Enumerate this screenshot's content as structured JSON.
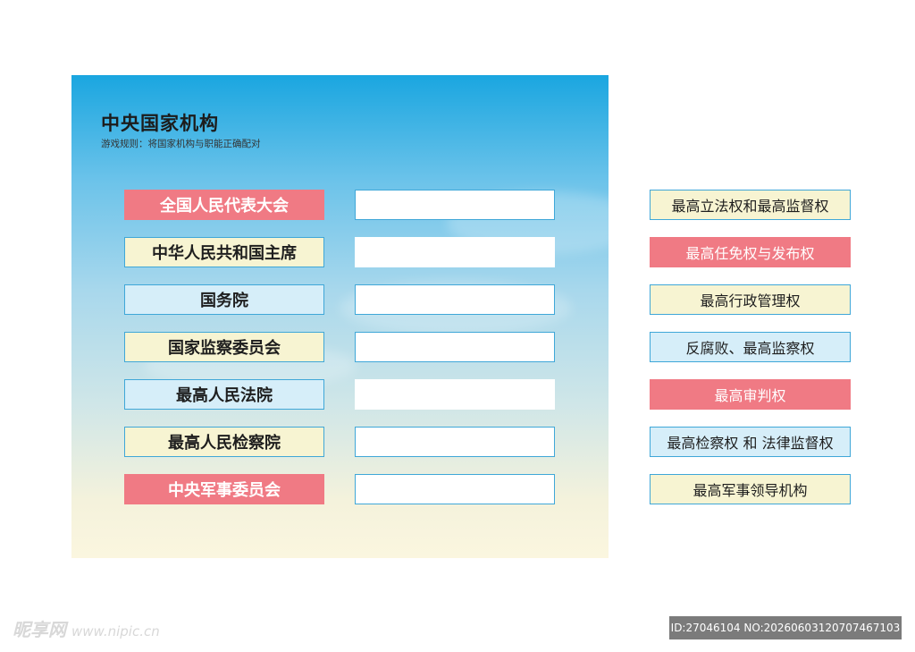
{
  "header": {
    "title": "中央国家机构",
    "rules": "游戏规则：将国家机构与职能正确配对"
  },
  "institutions": [
    {
      "label": "全国人民代表大会",
      "color": "red"
    },
    {
      "label": "中华人民共和国主席",
      "color": "yellow"
    },
    {
      "label": "国务院",
      "color": "blue"
    },
    {
      "label": "国家监察委员会",
      "color": "yellow"
    },
    {
      "label": "最高人民法院",
      "color": "blue"
    },
    {
      "label": "最高人民检察院",
      "color": "yellow"
    },
    {
      "label": "中央军事委员会",
      "color": "red"
    }
  ],
  "functions": [
    {
      "label": "最高立法权和最高监督权",
      "color": "yellow"
    },
    {
      "label": "最高任免权与发布权",
      "color": "red"
    },
    {
      "label": "最高行政管理权",
      "color": "yellow"
    },
    {
      "label": "反腐败、最高监察权",
      "color": "blue"
    },
    {
      "label": "最高审判权",
      "color": "red"
    },
    {
      "label": "最高检察权 和 法律监督权",
      "color": "blue"
    },
    {
      "label": "最高军事领导机构",
      "color": "yellow"
    }
  ],
  "colors": {
    "red": "#f07a84",
    "yellow": "#f7f4d2",
    "blue": "#d6eef9",
    "border": "#3fa7d8"
  },
  "watermark": {
    "brand": "昵享网",
    "url": "www.nipic.cn",
    "id": "ID:27046104 NO:20260603120707467103"
  }
}
